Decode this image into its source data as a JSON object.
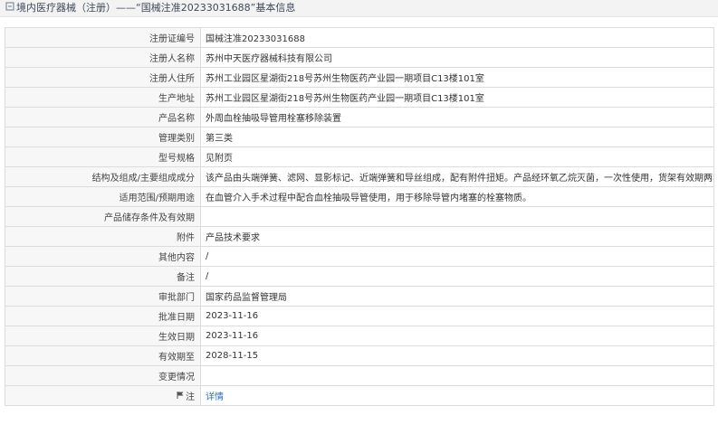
{
  "header": {
    "text": "境内医疗器械（注册）——“国械注准20233031688”基本信息"
  },
  "rows": [
    {
      "label": "注册证编号",
      "value": "国械注准20233031688"
    },
    {
      "label": "注册人名称",
      "value": "苏州中天医疗器械科技有限公司"
    },
    {
      "label": "注册人住所",
      "value": "苏州工业园区星湖街218号苏州生物医药产业园一期项目C13楼101室"
    },
    {
      "label": "生产地址",
      "value": "苏州工业园区星湖街218号苏州生物医药产业园一期项目C13楼101室"
    },
    {
      "label": "产品名称",
      "value": "外周血栓抽吸导管用栓塞移除装置"
    },
    {
      "label": "管理类别",
      "value": "第三类"
    },
    {
      "label": "型号规格",
      "value": "见附页"
    },
    {
      "label": "结构及组成/主要组成成分",
      "value": "该产品由头端弹簧、滤网、显影标记、近端弹簧和导丝组成，配有附件扭矩。产品经环氧乙烷灭菌，一次性使用，货架有效期两年。"
    },
    {
      "label": "适用范围/预期用途",
      "value": "在血管介入手术过程中配合血栓抽吸导管使用，用于移除导管内堵塞的栓塞物质。"
    },
    {
      "label": "产品储存条件及有效期",
      "value": ""
    },
    {
      "label": "附件",
      "value": "产品技术要求"
    },
    {
      "label": "其他内容",
      "value": "/"
    },
    {
      "label": "备注",
      "value": "/"
    },
    {
      "label": "审批部门",
      "value": "国家药品监督管理局"
    },
    {
      "label": "批准日期",
      "value": "2023-11-16"
    },
    {
      "label": "生效日期",
      "value": "2023-11-16"
    },
    {
      "label": "有效期至",
      "value": "2028-11-15"
    },
    {
      "label": "变更情况",
      "value": ""
    }
  ],
  "note_row": {
    "label": "注",
    "link_text": "详情",
    "icon": "flag-icon"
  },
  "colors": {
    "link": "#2a6fc0",
    "label_bg": "#f7f7f7",
    "border": "#dcdcdc"
  }
}
